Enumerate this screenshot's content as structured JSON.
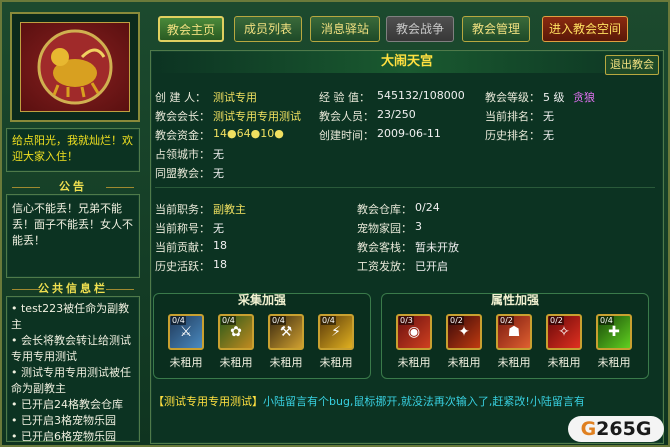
{
  "tabs": [
    "教会主页",
    "成员列表",
    "消息驿站",
    "教会战争",
    "教会管理",
    "进入教会空间"
  ],
  "motto": "给点阳光，我就灿烂！欢迎大家入住！",
  "notice_title": "公告",
  "notice": "信心不能丢！兄弟不能丢！面子不能丢！女人不能丢！",
  "news_title": "公共信息栏",
  "news": [
    "• test223被任命为副教主",
    "• 会长将教会转让给测试专用专用测试",
    "• 测试专用专用测试被任命为副教主",
    "• 已开启24格教会仓库",
    "• 已开启3格宠物乐园",
    "• 已开启6格宠物乐园"
  ],
  "title": "大闹天宫",
  "exit": "退出教会",
  "info": {
    "founder_l": "创 建 人：",
    "founder": "测试专用",
    "exp_l": "经 验 值：",
    "exp": "545132/108000",
    "level_l": "教会等级：",
    "level": "5 级",
    "level_name": "贪狼",
    "leader_l": "教会会长：",
    "leader": "测试专用专用测试",
    "members_l": "教会人员：",
    "members": "23/250",
    "rank_l": "当前排名：",
    "rank": "无",
    "funds_l": "教会资金：",
    "funds": "14●64●10●",
    "created_l": "创建时间：",
    "created": "2009-06-11",
    "hist_l": "历史排名：",
    "hist": "无",
    "city_l": "占领城市：",
    "city": "无",
    "ally_l": "同盟教会：",
    "ally": "无"
  },
  "mine": {
    "pos_l": "当前职务：",
    "pos": "副教主",
    "store_l": "教会仓库：",
    "store": "0/24",
    "title_l": "当前称号：",
    "title": "无",
    "pet_l": "宠物家园：",
    "pet": "3",
    "contrib_l": "当前贡献：",
    "contrib": "18",
    "inn_l": "教会客栈：",
    "inn": "暂未开放",
    "hact_l": "历史活跃：",
    "hact": "18",
    "wage_l": "工资发放：",
    "wage": "已开启"
  },
  "gather": {
    "title": "采集加强",
    "skills": [
      {
        "count": "0/4",
        "label": "未租用"
      },
      {
        "count": "0/4",
        "label": "未租用"
      },
      {
        "count": "0/4",
        "label": "未租用"
      },
      {
        "count": "0/4",
        "label": "未租用"
      }
    ]
  },
  "attr": {
    "title": "属性加强",
    "skills": [
      {
        "count": "0/3",
        "label": "未租用"
      },
      {
        "count": "0/2",
        "label": "未租用"
      },
      {
        "count": "0/2",
        "label": "未租用"
      },
      {
        "count": "0/2",
        "label": "未租用"
      },
      {
        "count": "0/4",
        "label": "未租用"
      }
    ]
  },
  "msg_name": "【测试专用专用测试】",
  "msg_text": "小陆留言有个bug,鼠标挪开,就没法再次输入了,赶紧改!小陆留言有",
  "logo_g": "G",
  "logo": "265G"
}
